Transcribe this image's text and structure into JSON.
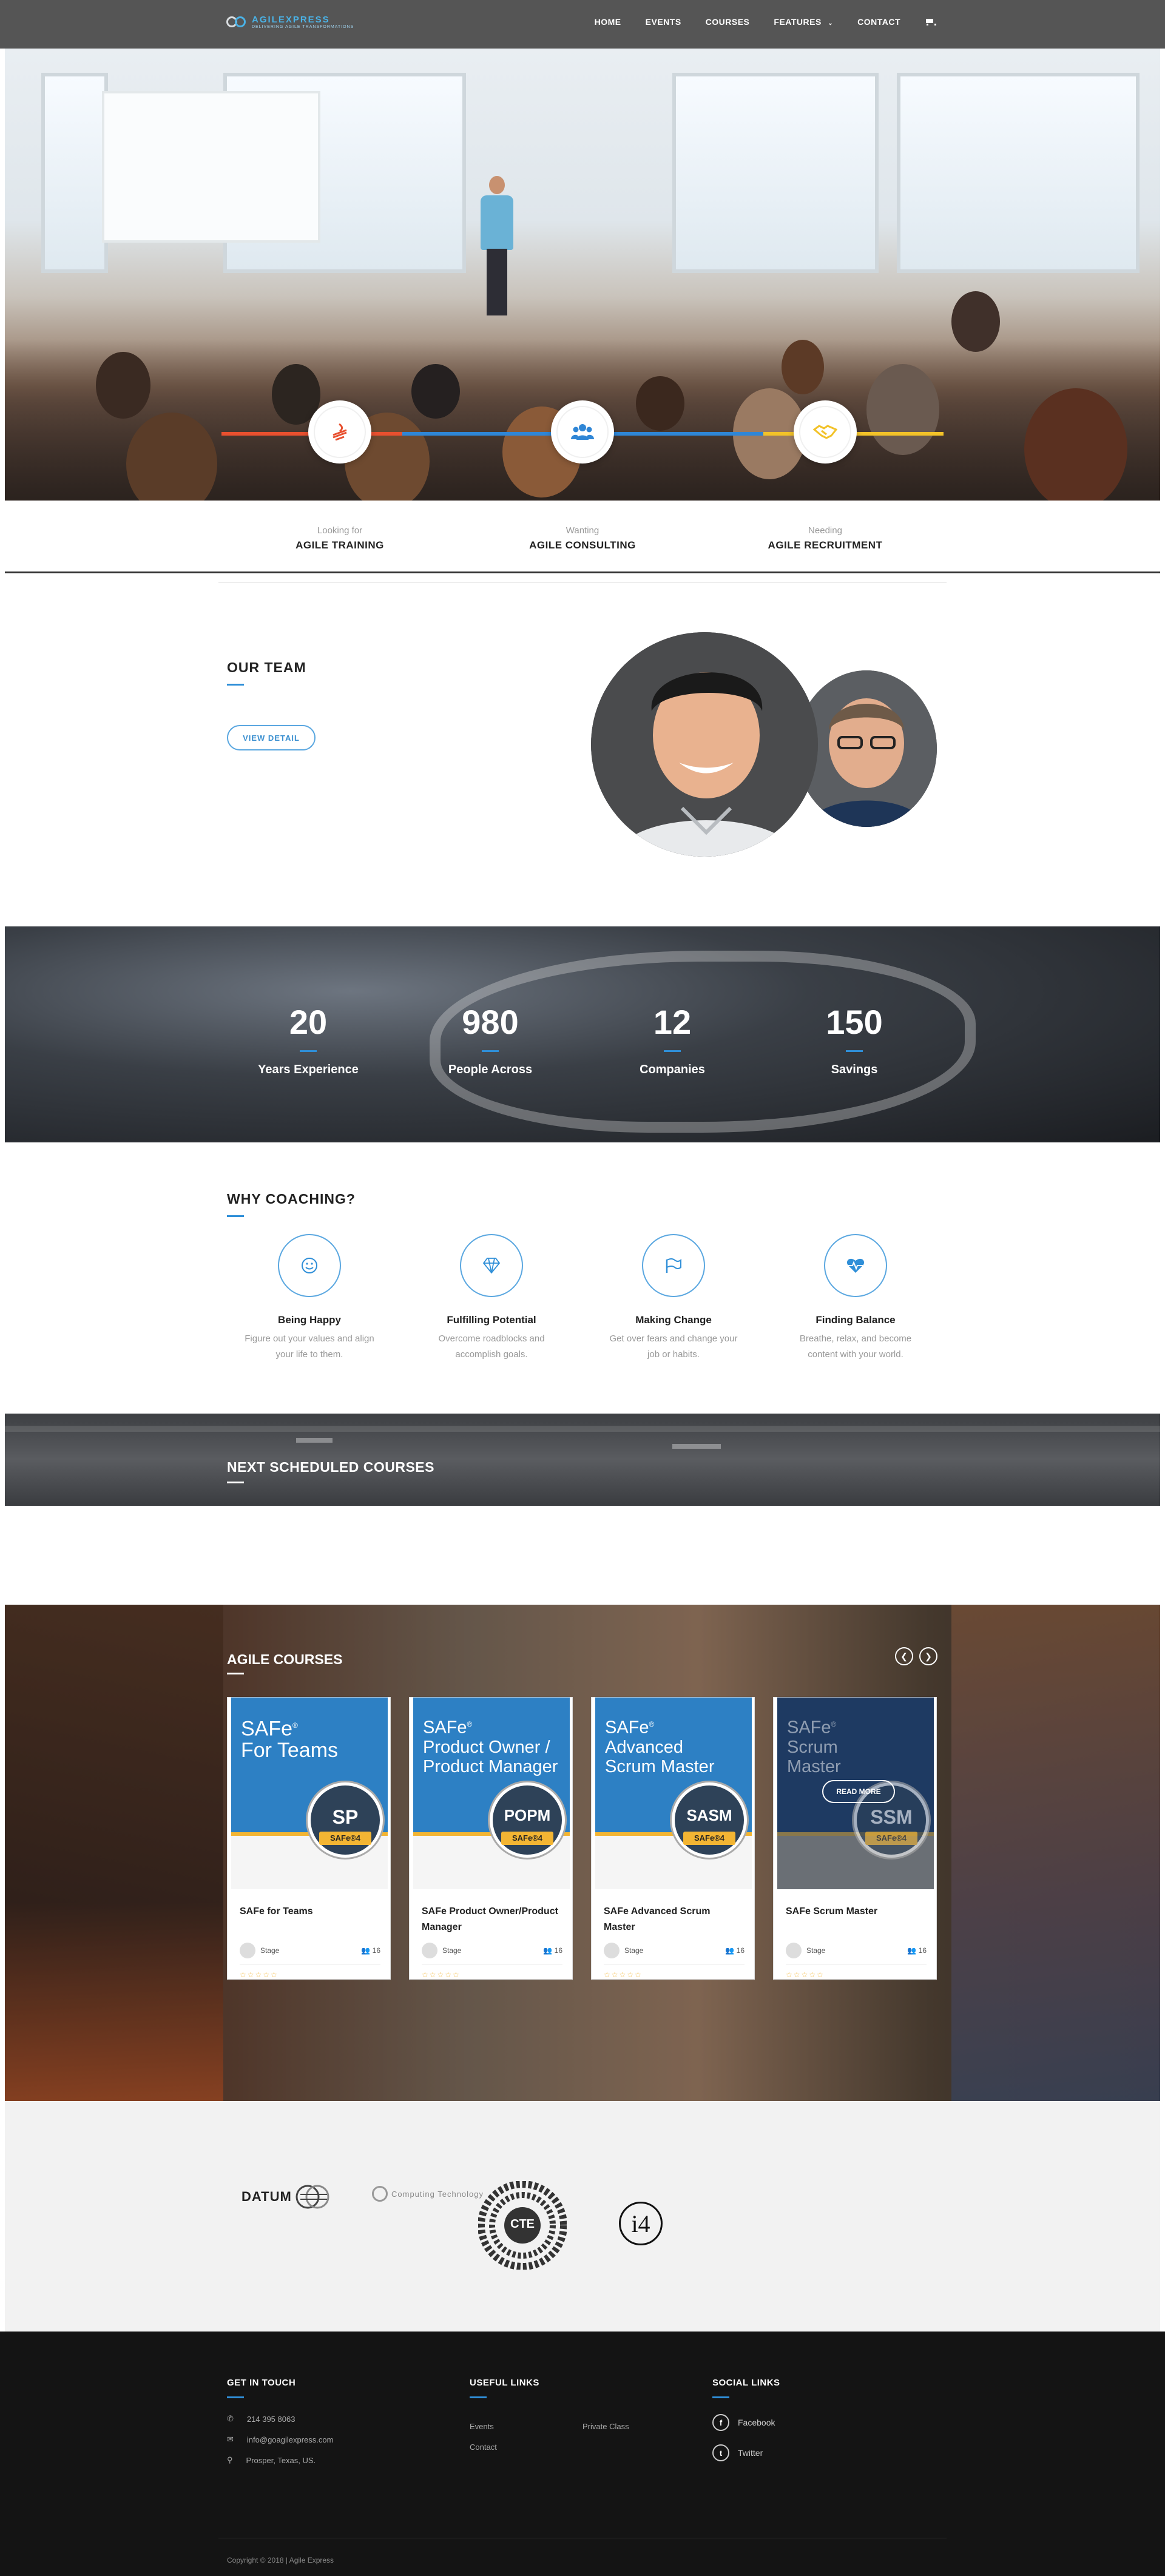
{
  "header": {
    "brand": "AGILEXPRESS",
    "tagline": "DELIVERING AGILE TRANSFORMATIONS",
    "nav": [
      "HOME",
      "EVENTS",
      "COURSES",
      "FEATURES",
      "CONTACT"
    ],
    "accent": "#4ab2e6"
  },
  "hero": {
    "features": [
      {
        "small": "Looking for",
        "big": "AGILE TRAINING",
        "color": "#e8502f",
        "icon": "graduation-icon"
      },
      {
        "small": "Wanting",
        "big": "AGILE CONSULTING",
        "color": "#2f86d6",
        "icon": "people-icon"
      },
      {
        "small": "Needing",
        "big": "AGILE RECRUITMENT",
        "color": "#f2c229",
        "icon": "handshake-icon"
      }
    ]
  },
  "team": {
    "title": "OUR TEAM",
    "button": "VIEW DETAIL"
  },
  "stats": [
    {
      "value": "20",
      "label": "Years Experience"
    },
    {
      "value": "980",
      "label": "People Across"
    },
    {
      "value": "12",
      "label": "Companies"
    },
    {
      "value": "150",
      "label": "Savings"
    }
  ],
  "coaching": {
    "title": "WHY COACHING?",
    "items": [
      {
        "title": "Being Happy",
        "line1": "Figure out your values and align",
        "line2": "your life to them.",
        "icon": "smile-icon"
      },
      {
        "title": "Fulfilling Potential",
        "line1": "Overcome roadblocks and",
        "line2": "accomplish goals.",
        "icon": "diamond-icon"
      },
      {
        "title": "Making Change",
        "line1": "Get over fears and change your",
        "line2": "job or habits.",
        "icon": "flag-icon"
      },
      {
        "title": "Finding Balance",
        "line1": "Breathe, relax, and become",
        "line2": "content with your world.",
        "icon": "heartbeat-icon"
      }
    ]
  },
  "scheduled": {
    "title": "NEXT SCHEDULED COURSES"
  },
  "courses": {
    "title": "AGILE COURSES",
    "read_more": "READ MORE",
    "items": [
      {
        "cover1": "SAFe",
        "cover2": "For Teams",
        "cover3": "",
        "code": "SP",
        "version": "SAFe®4",
        "title": "SAFe for Teams",
        "who": "Stage",
        "count": "16"
      },
      {
        "cover1": "SAFe",
        "cover2": "Product Owner /",
        "cover3": "Product Manager",
        "code": "POPM",
        "version": "SAFe®4",
        "title": "SAFe Product Owner/Product Manager",
        "who": "Stage",
        "count": "16"
      },
      {
        "cover1": "SAFe",
        "cover2": "Advanced",
        "cover3": "Scrum Master",
        "code": "SASM",
        "version": "SAFe®4",
        "title": "SAFe Advanced Scrum Master",
        "who": "Stage",
        "count": "16"
      },
      {
        "cover1": "SAFe",
        "cover2": "Scrum",
        "cover3": "Master",
        "code": "SSM",
        "version": "SAFe®4",
        "title": "SAFe Scrum Master",
        "who": "Stage",
        "count": "16"
      }
    ]
  },
  "partners": [
    "DATUM",
    "Computing Technology",
    "CTE",
    "i4"
  ],
  "footer": {
    "contact_title": "GET IN TOUCH",
    "phone": "214 395 8063",
    "email": "info@goagilexpress.com",
    "address": "Prosper, Texas, US.",
    "links_title": "USEFUL LINKS",
    "links": [
      "Events",
      "Private Class",
      "Contact"
    ],
    "social_title": "SOCIAL LINKS",
    "social": [
      "Facebook",
      "Twitter"
    ],
    "copyright": "Copyright © 2018 | Agile Express"
  }
}
